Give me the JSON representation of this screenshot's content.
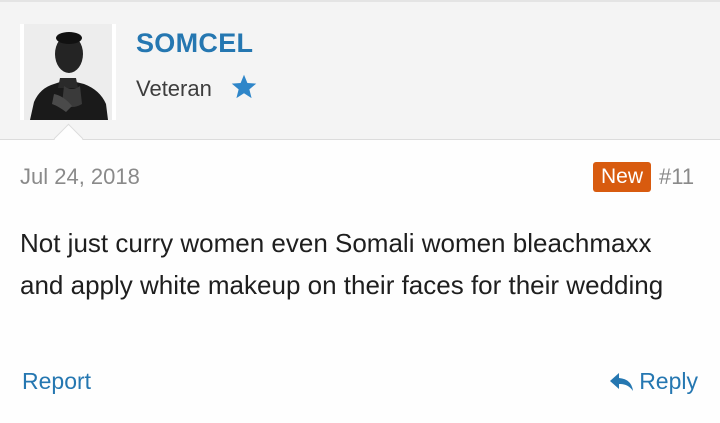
{
  "author": {
    "username": "SOMCEL",
    "user_title": "Veteran",
    "badge_icon": "star-icon",
    "star_color": "#2f86c9"
  },
  "post": {
    "date": "Jul 24, 2018",
    "new_label": "New",
    "number": "#11",
    "message": "Not just curry women even Somali women bleachmaxx and apply white makeup on their faces for their wedding"
  },
  "actions": {
    "report_label": "Report",
    "reply_label": "Reply"
  },
  "colors": {
    "link": "#2577b1",
    "new_badge": "#d85b0f"
  }
}
